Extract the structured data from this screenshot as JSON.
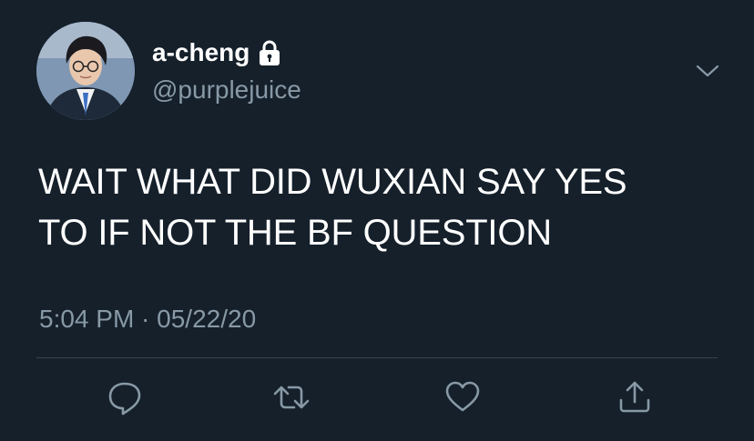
{
  "tweet": {
    "display_name": "a-cheng",
    "handle": "@purplejuice",
    "text_lines": [
      "WAIT WHAT DID WUXIAN SAY YES",
      "TO IF NOT THE BF QUESTION"
    ],
    "timestamp": "5:04 PM · 05/22/20",
    "protected_icon": "lock-icon",
    "menu_icon": "chevron-down-icon"
  },
  "actions": [
    {
      "name": "reply-icon"
    },
    {
      "name": "retweet-icon"
    },
    {
      "name": "like-icon"
    },
    {
      "name": "share-icon"
    }
  ],
  "colors": {
    "background": "#15202b",
    "primary_text": "#ffffff",
    "secondary_text": "#8899a6",
    "divider": "#38444d"
  }
}
